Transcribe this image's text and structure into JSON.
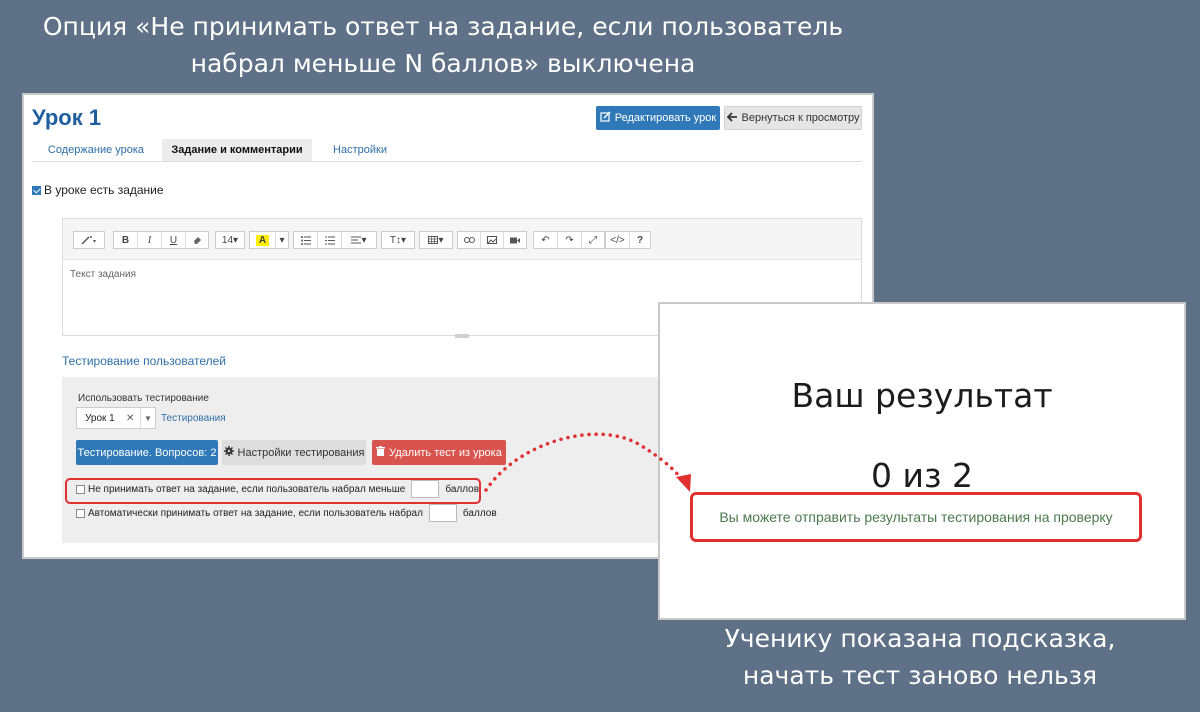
{
  "captions": {
    "top_line1": "Опция «Не принимать ответ на задание, если пользователь",
    "top_line2": "набрал меньше N баллов» выключена",
    "bottom_line1": "Ученику показана подсказка,",
    "bottom_line2": "начать тест заново нельзя"
  },
  "lesson": {
    "title": "Урок 1",
    "edit_button": "Редактировать урок",
    "back_button": "Вернуться к просмотру",
    "tabs": [
      {
        "label": "Содержание урока",
        "active": false
      },
      {
        "label": "Задание и комментарии",
        "active": true
      },
      {
        "label": "Настройки",
        "active": false
      }
    ],
    "has_task_label": "В уроке есть задание",
    "has_task_checked": true
  },
  "editor": {
    "placeholder": "Текст задания",
    "font_size": "14",
    "icons": [
      "magic-wand-icon",
      "bold-icon",
      "italic-icon",
      "underline-icon",
      "eraser-icon",
      "font-size-icon",
      "text-color-icon",
      "unordered-list-icon",
      "ordered-list-icon",
      "align-icon",
      "text-style-icon",
      "table-icon",
      "link-icon",
      "image-icon",
      "video-icon",
      "undo-icon",
      "redo-icon",
      "fullscreen-icon",
      "code-view-icon",
      "help-icon"
    ]
  },
  "testing": {
    "section_title": "Тестирование пользователей",
    "use_label": "Использовать тестирование",
    "selected_test": "Урок 1",
    "tests_link": "Тестирования",
    "tests_button": "Тестирование. Вопросов: 2",
    "settings_button": "Настройки тестирования",
    "delete_button": "Удалить тест из урока",
    "option1_text": "Не принимать ответ на задание, если пользователь набрал меньше",
    "option1_checked": false,
    "option1_suffix": "баллов",
    "option2_text": "Автоматически принимать ответ на задание, если пользователь набрал",
    "option2_checked": false,
    "option2_suffix": "баллов"
  },
  "result": {
    "title": "Ваш результат",
    "score": "0 из 2",
    "hint": "Вы можете отправить результаты тестирования на проверку"
  },
  "colors": {
    "background": "#5f7186",
    "primary": "#2f79b9",
    "danger": "#d9534f",
    "highlight": "#e03030",
    "hint_text": "#4d7a50"
  }
}
